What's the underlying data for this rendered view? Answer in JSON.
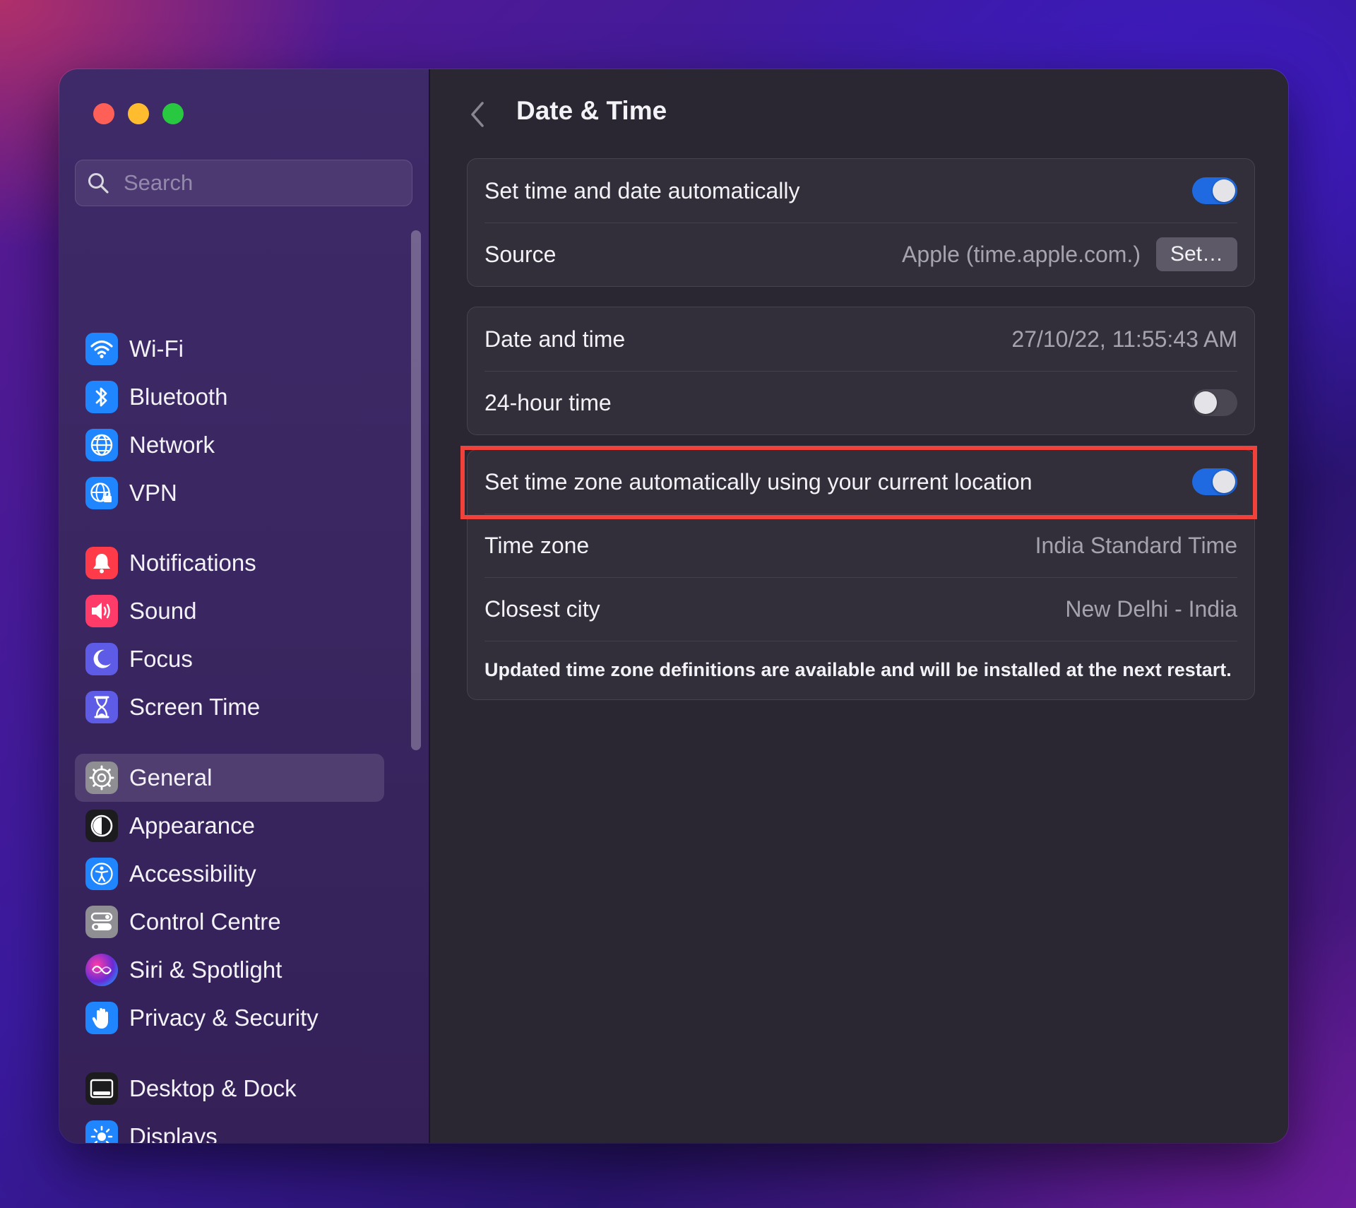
{
  "window": {
    "traffic_lights": [
      "close",
      "minimize",
      "zoom"
    ]
  },
  "sidebar": {
    "search": {
      "placeholder": "Search",
      "value": ""
    },
    "items": [
      {
        "label": "Wi-Fi",
        "icon": "wifi-icon",
        "color": "#1f86ff"
      },
      {
        "label": "Bluetooth",
        "icon": "bluetooth-icon",
        "color": "#1f86ff"
      },
      {
        "label": "Network",
        "icon": "globe-icon",
        "color": "#1f86ff"
      },
      {
        "label": "VPN",
        "icon": "vpn-globe-icon",
        "color": "#1f86ff"
      },
      {
        "label": "Notifications",
        "icon": "bell-icon",
        "color": "#ff3b4a"
      },
      {
        "label": "Sound",
        "icon": "speaker-icon",
        "color": "#ff3b6a"
      },
      {
        "label": "Focus",
        "icon": "moon-icon",
        "color": "#5e5ce6"
      },
      {
        "label": "Screen Time",
        "icon": "hourglass-icon",
        "color": "#5e5ce6"
      },
      {
        "label": "General",
        "icon": "gear-icon",
        "color": "#8e8e93",
        "active": true
      },
      {
        "label": "Appearance",
        "icon": "appearance-icon",
        "color": "#1c1c1e"
      },
      {
        "label": "Accessibility",
        "icon": "accessibility-icon",
        "color": "#1f86ff"
      },
      {
        "label": "Control Centre",
        "icon": "control-centre-icon",
        "color": "#8e8e93"
      },
      {
        "label": "Siri & Spotlight",
        "icon": "siri-icon",
        "color": "#6a2bd6"
      },
      {
        "label": "Privacy & Security",
        "icon": "hand-icon",
        "color": "#1f86ff"
      },
      {
        "label": "Desktop & Dock",
        "icon": "dock-icon",
        "color": "#1c1c1e"
      },
      {
        "label": "Displays",
        "icon": "sun-icon",
        "color": "#1f86ff"
      }
    ]
  },
  "main": {
    "title": "Date & Time",
    "group1": {
      "auto_time_label": "Set time and date automatically",
      "auto_time_on": true,
      "source_label": "Source",
      "source_value": "Apple (time.apple.com.)",
      "set_button": "Set…"
    },
    "group2": {
      "date_label": "Date and time",
      "date_value": "27/10/22, 11:55:43 AM",
      "hour24_label": "24-hour time",
      "hour24_on": false
    },
    "group3": {
      "auto_tz_label": "Set time zone automatically using your current location",
      "auto_tz_on": true,
      "tz_label": "Time zone",
      "tz_value": "India Standard Time",
      "city_label": "Closest city",
      "city_value": "New Delhi - India",
      "note": "Updated time zone definitions are available and will be installed at the next restart."
    },
    "help_label": "?"
  },
  "colors": {
    "accent": "#1f6ae0",
    "highlight": "#f0413a"
  }
}
